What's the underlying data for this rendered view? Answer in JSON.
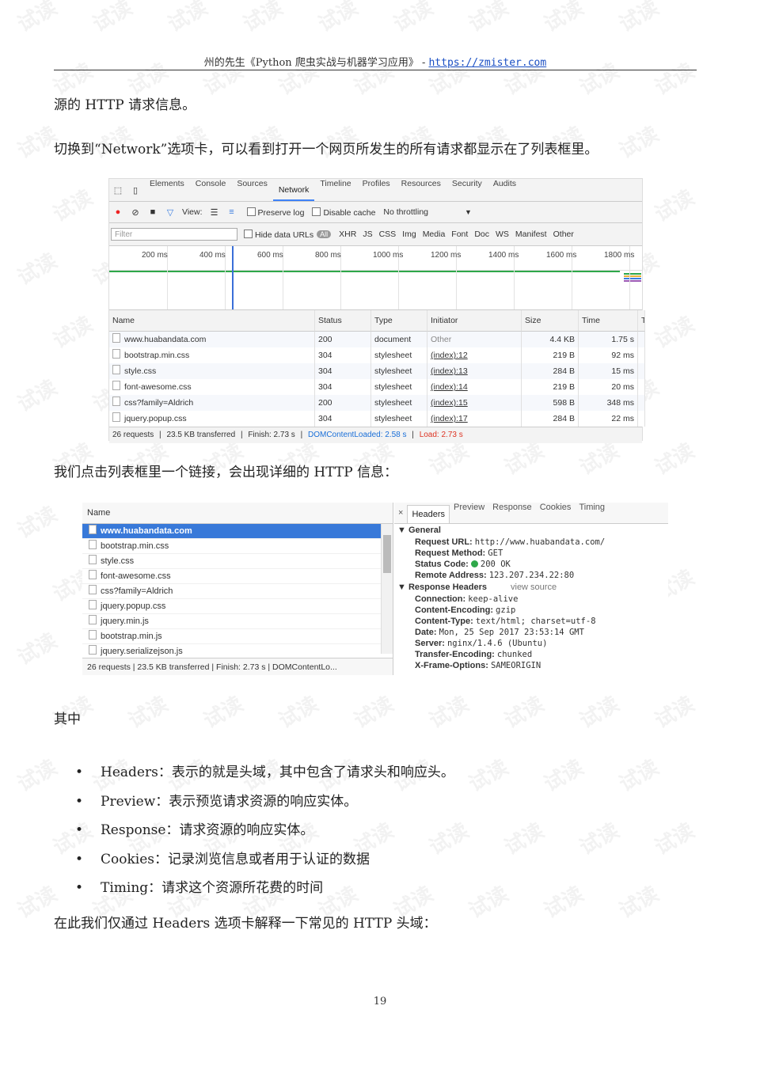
{
  "header": {
    "text": "州的先生《Python 爬虫实战与机器学习应用》 - ",
    "link": "https://zmister.com"
  },
  "watermark": "试读",
  "paragraphs": {
    "p1": "源的 HTTP 请求信息。",
    "p2": "切换到“Network”选项卡，可以看到打开一个网页所发生的所有请求都显示在了列表框里。",
    "p3": "我们点击列表框里一个链接，会出现详细的 HTTP 信息：",
    "p4": "其中",
    "p5": "在此我们仅通过 Headers 选项卡解释一下常见的 HTTP 头域："
  },
  "devtools": {
    "tabs": [
      "Elements",
      "Console",
      "Sources",
      "Network",
      "Timeline",
      "Profiles",
      "Resources",
      "Security",
      "Audits"
    ],
    "active_tab": "Network",
    "toolbar": {
      "view": "View:",
      "preserve_log": "Preserve log",
      "disable_cache": "Disable cache",
      "throttling": "No throttling",
      "dropdown": "▼"
    },
    "filterbar": {
      "placeholder": "Filter",
      "hide_data_urls": "Hide data URLs",
      "all": "All",
      "types": [
        "XHR",
        "JS",
        "CSS",
        "Img",
        "Media",
        "Font",
        "Doc",
        "WS",
        "Manifest",
        "Other"
      ]
    },
    "ticks": [
      "200 ms",
      "400 ms",
      "600 ms",
      "800 ms",
      "1000 ms",
      "1200 ms",
      "1400 ms",
      "1600 ms",
      "1800 ms"
    ],
    "columns": [
      "Name",
      "Status",
      "Type",
      "Initiator",
      "Size",
      "Time",
      "Ti"
    ],
    "rows": [
      {
        "name": "www.huabandata.com",
        "status": "200",
        "type": "document",
        "initiator": "Other",
        "size": "4.4 KB",
        "time": "1.75 s"
      },
      {
        "name": "bootstrap.min.css",
        "status": "304",
        "type": "stylesheet",
        "initiator": "(index):12",
        "size": "219 B",
        "time": "92 ms"
      },
      {
        "name": "style.css",
        "status": "304",
        "type": "stylesheet",
        "initiator": "(index):13",
        "size": "284 B",
        "time": "15 ms"
      },
      {
        "name": "font-awesome.css",
        "status": "304",
        "type": "stylesheet",
        "initiator": "(index):14",
        "size": "219 B",
        "time": "20 ms"
      },
      {
        "name": "css?family=Aldrich",
        "status": "200",
        "type": "stylesheet",
        "initiator": "(index):15",
        "size": "598 B",
        "time": "348 ms"
      },
      {
        "name": "jquery.popup.css",
        "status": "304",
        "type": "stylesheet",
        "initiator": "(index):17",
        "size": "284 B",
        "time": "22 ms"
      }
    ],
    "statusbar": {
      "requests": "26 requests",
      "transferred": "23.5 KB transferred",
      "finish": "Finish: 2.73 s",
      "dom": "DOMContentLoaded: 2.58 s",
      "load": "Load: 2.73 s",
      "sep": "|"
    }
  },
  "detail": {
    "name_header": "Name",
    "files": [
      "www.huabandata.com",
      "bootstrap.min.css",
      "style.css",
      "font-awesome.css",
      "css?family=Aldrich",
      "jquery.popup.css",
      "jquery.min.js",
      "bootstrap.min.js",
      "jquery.serializejson.js"
    ],
    "statusbar": "26 requests  |  23.5 KB transferred  |  Finish: 2.73 s  |  DOMContentLo...",
    "close": "×",
    "tabs": [
      "Headers",
      "Preview",
      "Response",
      "Cookies",
      "Timing"
    ],
    "general_title": "▼ General",
    "general": [
      {
        "k": "Request URL:",
        "v": "http://www.huabandata.com/"
      },
      {
        "k": "Request Method:",
        "v": "GET"
      },
      {
        "k": "Status Code:",
        "v": "200 OK"
      },
      {
        "k": "Remote Address:",
        "v": "123.207.234.22:80"
      }
    ],
    "response_title": "▼ Response Headers",
    "view_source": "view source",
    "response": [
      {
        "k": "Connection:",
        "v": "keep-alive"
      },
      {
        "k": "Content-Encoding:",
        "v": "gzip"
      },
      {
        "k": "Content-Type:",
        "v": "text/html; charset=utf-8"
      },
      {
        "k": "Date:",
        "v": "Mon, 25 Sep 2017 23:53:14 GMT"
      },
      {
        "k": "Server:",
        "v": "nginx/1.4.6 (Ubuntu)"
      },
      {
        "k": "Transfer-Encoding:",
        "v": "chunked"
      },
      {
        "k": "X-Frame-Options:",
        "v": "SAMEORIGIN"
      }
    ]
  },
  "bullets": [
    "Headers：表示的就是头域，其中包含了请求头和响应头。",
    "Preview：表示预览请求资源的响应实体。",
    "Response：请求资源的响应实体。",
    "Cookies：记录浏览信息或者用于认证的数据",
    "Timing：请求这个资源所花费的时间"
  ],
  "page_number": "19"
}
